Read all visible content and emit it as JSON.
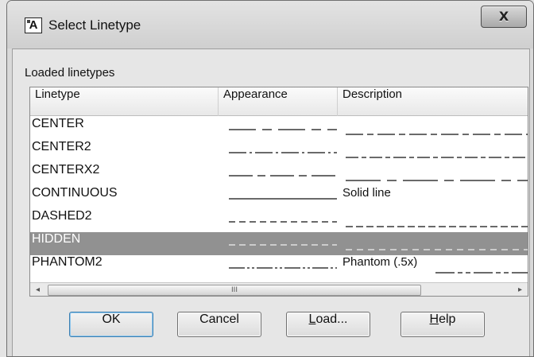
{
  "window": {
    "title": "Select Linetype",
    "app_icon_letter": "A",
    "close_label": "X"
  },
  "section_label": "Loaded linetypes",
  "columns": [
    "Linetype",
    "Appearance",
    "Description"
  ],
  "rows": [
    {
      "name": "CENTER",
      "description": "",
      "pattern": "center",
      "desc_pattern": "center",
      "selected": false
    },
    {
      "name": "CENTER2",
      "description": "",
      "pattern": "center2",
      "desc_pattern": "center2",
      "selected": false
    },
    {
      "name": "CENTERX2",
      "description": "",
      "pattern": "centerx2",
      "desc_pattern": "centerx2",
      "selected": false
    },
    {
      "name": "CONTINUOUS",
      "description": "Solid line",
      "pattern": "continuous",
      "desc_pattern": "none",
      "selected": false
    },
    {
      "name": "DASHED2",
      "description": "",
      "pattern": "dashed",
      "desc_pattern": "dashed",
      "selected": false
    },
    {
      "name": "HIDDEN",
      "description": "",
      "pattern": "hidden",
      "desc_pattern": "hidden",
      "selected": true
    },
    {
      "name": "PHANTOM2",
      "description": "Phantom (.5x)",
      "pattern": "phantom",
      "desc_pattern": "phantom",
      "selected": false
    }
  ],
  "scrollbar": {
    "left_arrow": "◂",
    "right_arrow": "▸",
    "grip": "III"
  },
  "buttons": {
    "ok": "OK",
    "cancel": "Cancel",
    "load_mnemonic": "L",
    "load_rest": "oad...",
    "help_mnemonic": "H",
    "help_rest": "elp"
  },
  "colors": {
    "selection": "#919191",
    "dialog_bg": "#e6e6e6"
  }
}
